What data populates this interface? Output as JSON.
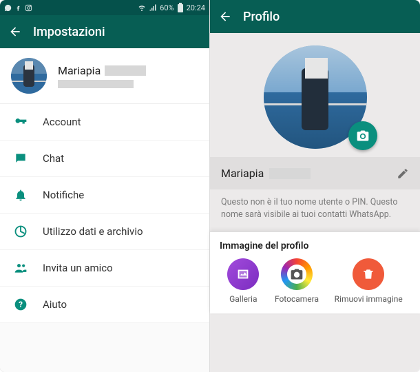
{
  "statusbar": {
    "time": "20:24",
    "battery": "60%",
    "icons_left": [
      "whatsapp",
      "facebook",
      "instagram"
    ],
    "icons_right": [
      "wifi",
      "signal",
      "battery"
    ]
  },
  "left": {
    "title": "Impostazioni",
    "profile_name": "Mariapia",
    "menu": [
      {
        "icon": "key",
        "label": "Account"
      },
      {
        "icon": "chat",
        "label": "Chat"
      },
      {
        "icon": "bell",
        "label": "Notifiche"
      },
      {
        "icon": "data",
        "label": "Utilizzo dati e archivio"
      },
      {
        "icon": "invite",
        "label": "Invita un amico"
      },
      {
        "icon": "help",
        "label": "Aiuto"
      }
    ]
  },
  "right": {
    "title": "Profilo",
    "name": "Mariapia",
    "hint": "Questo non è il tuo nome utente o PIN. Questo nome sarà visibile ai tuoi contatti WhatsApp.",
    "sheet_title": "Immagine del profilo",
    "options": {
      "gallery": "Galleria",
      "camera": "Fotocamera",
      "remove": "Rimuovi immagine"
    }
  },
  "colors": {
    "brand": "#075e54",
    "accent": "#0a8f7e"
  }
}
